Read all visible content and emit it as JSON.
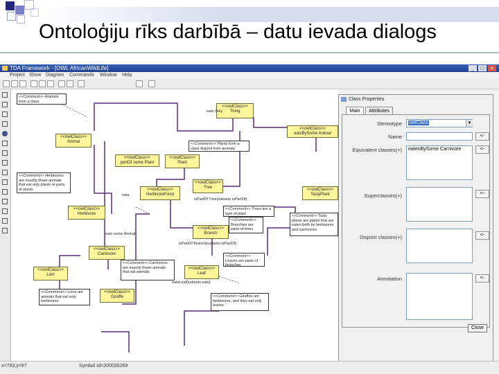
{
  "slide": {
    "title": "Ontoloģiju rīks darbībā – datu ievada dialogs"
  },
  "window": {
    "title": "TDA Framework - [OWL AfricanWildLife]",
    "controls": [
      "_",
      "□",
      "×"
    ],
    "menu": [
      "Project",
      "Show",
      "Diagram",
      "Commands",
      "Window",
      "Help"
    ]
  },
  "diagram": {
    "classes": [
      {
        "id": "thing",
        "stereo": "<<owlClass>>",
        "name": "Thing"
      },
      {
        "id": "animal",
        "stereo": "<<owlClass>>",
        "name": "Animal"
      },
      {
        "id": "plant",
        "stereo": "<<owlClass>>",
        "name": "Plant"
      },
      {
        "id": "tree",
        "stereo": "<<owlClass>>",
        "name": "Tree"
      },
      {
        "id": "herbivore",
        "stereo": "<<owlClass>>",
        "name": "Herbivore"
      },
      {
        "id": "herbivorefood",
        "stereo": "<<owlClass>>",
        "name": "HerbivoreFood"
      },
      {
        "id": "tastyplant",
        "stereo": "<<owlClass>>",
        "name": "TastyPlant"
      },
      {
        "id": "branch",
        "stereo": "<<owlClass>>",
        "name": "Branch"
      },
      {
        "id": "carnivore",
        "stereo": "<<owlClass>>",
        "name": "Carnivore"
      },
      {
        "id": "lion",
        "stereo": "<<owlClass>>",
        "name": "Lion"
      },
      {
        "id": "leaf",
        "stereo": "<<owlClass>>",
        "name": "Leaf"
      },
      {
        "id": "giraffe",
        "stereo": "<<owlClass>>",
        "name": "Giraffe"
      },
      {
        "id": "sub1",
        "stereo": "<<owlClass>>",
        "name": "eatsBySome Animal"
      },
      {
        "id": "sub2",
        "stereo": "<<owlClass>>",
        "name": "partOf some Plant"
      }
    ],
    "comments": [
      {
        "id": "c1",
        "text": "<<Comment>> Animals form a class"
      },
      {
        "id": "c2",
        "text": "<<Comment>> Plants form a class disjoint from animals"
      },
      {
        "id": "c3",
        "text": "<<Comment>> Herbivores are exactly those animals that eat only plants or parts of plants"
      },
      {
        "id": "c4",
        "text": "<<Comment>> Trees are a type of plant"
      },
      {
        "id": "c5",
        "text": "<<Comment>> Branches are parts of trees"
      },
      {
        "id": "c6",
        "text": "<<Comment>> Tasty plants are plants that are eaten both by herbivores and carnivores"
      },
      {
        "id": "c7",
        "text": "<<Comment>> Leaves are parts of branches"
      },
      {
        "id": "c8",
        "text": "<<Comment>> Carnivores are exactly those animals that eat animals"
      },
      {
        "id": "c9",
        "text": "<<Comment>> Lions are animals that eat only herbivores"
      },
      {
        "id": "c10",
        "text": "<<Comment>> Giraffes are herbivores, and they eat only leaves"
      }
    ],
    "relations": [
      {
        "id": "r1",
        "text": "eats Only"
      },
      {
        "id": "r2",
        "text": "eats some Animal"
      },
      {
        "id": "r3",
        "text": "isPartOf Branch{subsets isPartOf}"
      },
      {
        "id": "r4",
        "text": "isPartOf Tree{subsets isPartOf}"
      },
      {
        "id": "r5",
        "text": "eatsLeaf{subsets eats}"
      },
      {
        "id": "r6",
        "text": "eats"
      }
    ]
  },
  "dialog": {
    "title": "Class Properties",
    "tabs": [
      "Main",
      "Attributes"
    ],
    "fields": {
      "stereotype": {
        "label": "Stereotype",
        "value": "owlClass"
      },
      "name": {
        "label": "Name",
        "value": ""
      },
      "equivalent": {
        "label": "Equivalent classes(+)",
        "value": "eatenBySome Carnivore"
      },
      "superclasses": {
        "label": "Superclasses(+)",
        "value": ""
      },
      "disjoint": {
        "label": "Disjoint classes(+)",
        "value": ""
      },
      "annotation": {
        "label": "Annotation",
        "value": ""
      }
    },
    "button_small": "<-",
    "close_label": "Close"
  },
  "status": {
    "coords": "x=793,y=97",
    "symbol": "Symbol Id=200035269"
  }
}
